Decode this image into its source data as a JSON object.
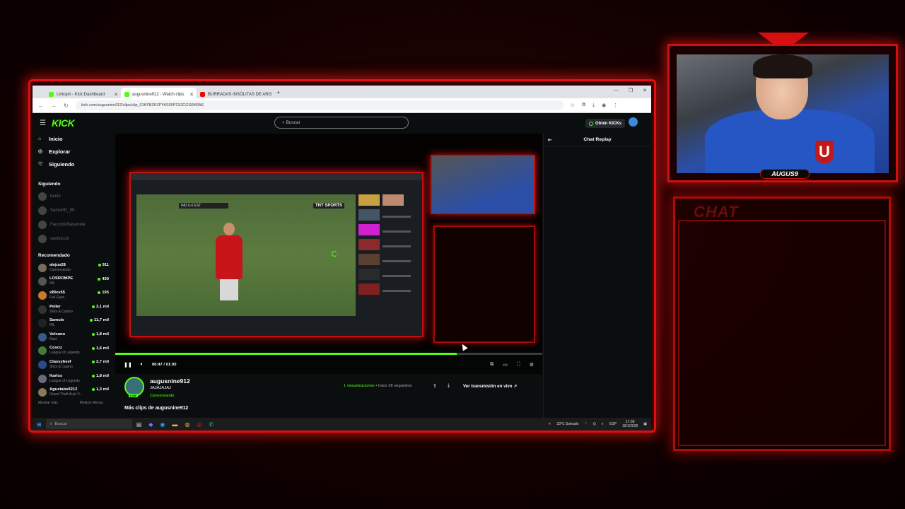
{
  "overlay": {
    "cam_name": "AUGUS9",
    "chat_title": "CHAT",
    "crest_letter": "U",
    "accent": "#e01010"
  },
  "browser": {
    "tabs": [
      {
        "label": "Unicam - Kick Dashboard",
        "color": "#53fc18"
      },
      {
        "label": "augusnine912 - Watch clips",
        "color": "#53fc18"
      },
      {
        "label": "BURRADAS INSÓLITAS DE ARG",
        "color": "#ff0000"
      }
    ],
    "url": "kick.com/augusnine912/clips/clip_01KFBZK3PYAS59P2X2CGS6M0AE"
  },
  "kick": {
    "logo": "KICK",
    "search_placeholder": "Buscar",
    "kicks_button": "Obtén KICKs",
    "nav": [
      {
        "label": "Inicio",
        "icon": "home-icon"
      },
      {
        "label": "Explorar",
        "icon": "compass-icon"
      },
      {
        "label": "Siguiendo",
        "icon": "heart-icon"
      }
    ],
    "following_heading": "Siguiendo",
    "following": [
      "baulo",
      "SamuHD_99",
      "FacundoNavarrete",
      "santiocchi"
    ],
    "recommended_heading": "Recomendado",
    "recommended": [
      {
        "name": "alejus28",
        "category": "Conversando",
        "viewers": "911",
        "color": "#7a6a5a"
      },
      {
        "name": "LOSROMPE",
        "category": "IRL",
        "viewers": "430",
        "color": "#555"
      },
      {
        "name": "xBlxs55",
        "category": "Fall Guys",
        "viewers": "195",
        "color": "#c87a30"
      },
      {
        "name": "Peller",
        "category": "Slots & Casino",
        "viewers": "3,1 mil",
        "color": "#333"
      },
      {
        "name": "Samulx",
        "category": "IRL",
        "viewers": "11,7 mil",
        "color": "#222"
      },
      {
        "name": "Volcano",
        "category": "Rust",
        "viewers": "1,8 mil",
        "color": "#3a5a8a"
      },
      {
        "name": "Coscu",
        "category": "League of Legends",
        "viewers": "1,6 mil",
        "color": "#4a7a3a"
      },
      {
        "name": "Classybeef",
        "category": "Slots & Casino",
        "viewers": "2,7 mil",
        "color": "#2a4a8a"
      },
      {
        "name": "Karlos",
        "category": "League of Legends",
        "viewers": "1,8 mil",
        "color": "#6a6a7a"
      },
      {
        "name": "Agustabell212",
        "category": "Grand Theft Auto V...",
        "viewers": "1,3 mil",
        "color": "#8a7a5a"
      }
    ],
    "show_more": "Mostrar más",
    "show_less": "Mostrar Menos",
    "player": {
      "current_time": "00:47",
      "duration": "01:00",
      "progress": 0.8,
      "score_text": "IND 0-0 EST",
      "broadcaster_logo": "TNT SPORTS"
    },
    "chat_replay": "Chat Replay",
    "clip": {
      "channel": "augusnine912",
      "title": "JAJAJAJAJ",
      "category": "Conversando",
      "live_badge": "LIVE",
      "views_count": "1 visualizaciones",
      "time_ago": " • hace 36 segundos",
      "live_link": "Ver transmisión en vivo",
      "more_clips": "Más clips de augusnine912"
    }
  },
  "taskbar": {
    "search": "Buscar",
    "weather": "23°C  Soleado",
    "lang": "ESP",
    "time": "17:38",
    "date": "16/1/2026"
  }
}
